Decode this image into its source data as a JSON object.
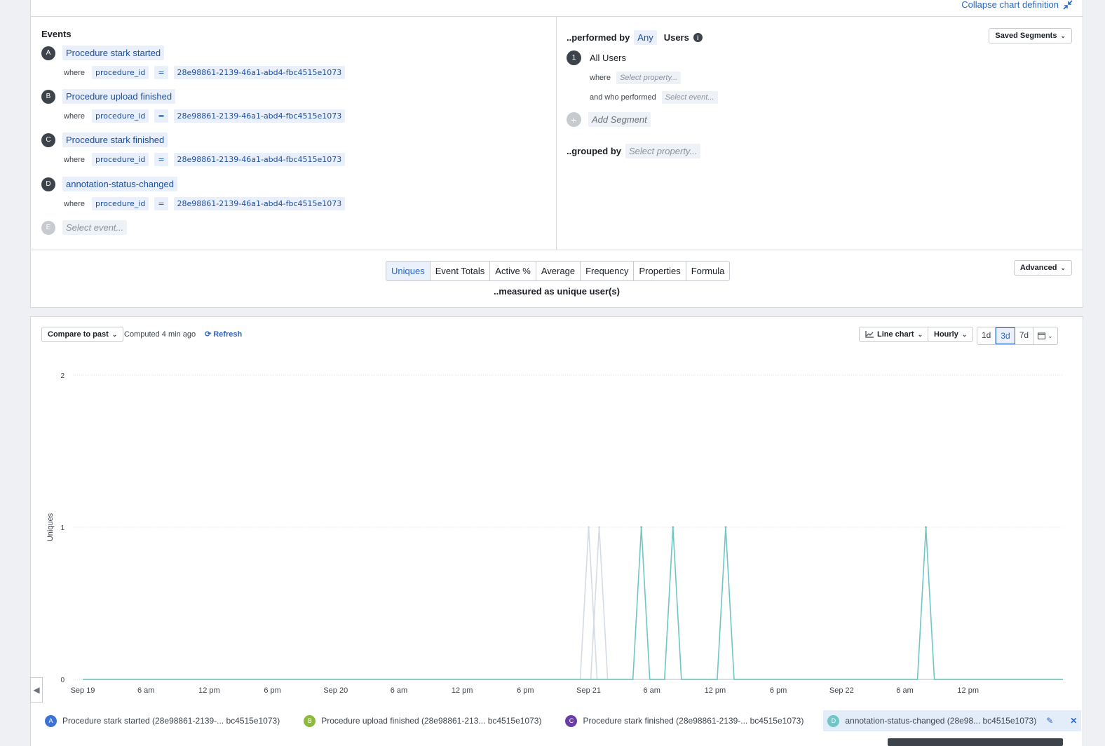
{
  "definition": {
    "collapse_label": "Collapse chart definition",
    "events_title": "Events",
    "events": [
      {
        "letter": "A",
        "name": "Procedure stark started",
        "where": "where",
        "prop": "procedure_id",
        "op": "=",
        "value": "28e98861-2139-46a1-abd4-fbc4515e1073"
      },
      {
        "letter": "B",
        "name": "Procedure upload finished",
        "where": "where",
        "prop": "procedure_id",
        "op": "=",
        "value": "28e98861-2139-46a1-abd4-fbc4515e1073"
      },
      {
        "letter": "C",
        "name": "Procedure stark finished",
        "where": "where",
        "prop": "procedure_id",
        "op": "=",
        "value": "28e98861-2139-46a1-abd4-fbc4515e1073"
      },
      {
        "letter": "D",
        "name": "annotation-status-changed",
        "where": "where",
        "prop": "procedure_id",
        "op": "=",
        "value": "28e98861-2139-46a1-abd4-fbc4515e1073"
      }
    ],
    "empty_event": {
      "letter": "E",
      "placeholder": "Select event..."
    },
    "performed_by": {
      "prefix": "..performed by",
      "any": "Any",
      "users": "Users",
      "info_icon": "info-icon"
    },
    "saved_segments": "Saved Segments",
    "segment": {
      "number": "1",
      "name": "All Users",
      "where": "where",
      "where_placeholder": "Select property...",
      "performed": "and who performed",
      "performed_placeholder": "Select event..."
    },
    "add_segment": "Add Segment",
    "grouped_by": {
      "label": "..grouped by",
      "placeholder": "Select property..."
    },
    "measure_tabs": [
      "Uniques",
      "Event Totals",
      "Active %",
      "Average",
      "Frequency",
      "Properties",
      "Formula"
    ],
    "active_tab": "Uniques",
    "measured_as": "..measured as unique user(s)",
    "advanced": "Advanced"
  },
  "toolbar": {
    "compare": "Compare to past",
    "computed": "Computed 4 min ago",
    "refresh": "Refresh",
    "chart_type": "Line chart",
    "interval": "Hourly",
    "ranges": [
      "1d",
      "3d",
      "7d"
    ],
    "active_range": "3d"
  },
  "chart_data": {
    "type": "line",
    "ylabel": "Uniques",
    "ylim": [
      0,
      2
    ],
    "yticks": [
      "0",
      "1",
      "2"
    ],
    "x_range_hours": [
      0,
      93
    ],
    "xticks": [
      {
        "label": "Sep 19",
        "hour": 0
      },
      {
        "label": "6 am",
        "hour": 6
      },
      {
        "label": "12 pm",
        "hour": 12
      },
      {
        "label": "6 pm",
        "hour": 18
      },
      {
        "label": "Sep 20",
        "hour": 24
      },
      {
        "label": "6 am",
        "hour": 30
      },
      {
        "label": "12 pm",
        "hour": 36
      },
      {
        "label": "6 pm",
        "hour": 42
      },
      {
        "label": "Sep 21",
        "hour": 48
      },
      {
        "label": "6 am",
        "hour": 54
      },
      {
        "label": "12 pm",
        "hour": 60
      },
      {
        "label": "6 pm",
        "hour": 66
      },
      {
        "label": "Sep 22",
        "hour": 72
      },
      {
        "label": "6 am",
        "hour": 78
      },
      {
        "label": "12 pm",
        "hour": 84
      }
    ],
    "series": [
      {
        "name": "Procedure stark started (28e98861-2139-... bc4515e1073)",
        "color": "#d5dbe2",
        "spikes": [
          48
        ]
      },
      {
        "name": "Procedure upload finished (28e98861-213... bc4515e1073)",
        "color": "#d5dbe2",
        "spikes": [
          49
        ]
      },
      {
        "name": "Procedure stark finished (28e98861-2139-... bc4515e1073)",
        "color": "#d5dbe2",
        "spikes": []
      },
      {
        "name": "annotation-status-changed (28e98... bc4515e1073)",
        "color": "#6ec6c6",
        "spikes": [
          53,
          56,
          61,
          80
        ]
      }
    ]
  },
  "legend": [
    {
      "letter": "A",
      "color": "#3b73d9",
      "label": "Procedure stark started (28e98861-2139-... bc4515e1073)"
    },
    {
      "letter": "B",
      "color": "#8db93e",
      "label": "Procedure upload finished (28e98861-213... bc4515e1073)"
    },
    {
      "letter": "C",
      "color": "#6a3ca7",
      "label": "Procedure stark finished (28e98861-2139-... bc4515e1073)"
    },
    {
      "letter": "D",
      "color": "#6ec6c6",
      "label": "annotation-status-changed (28e98... bc4515e1073)"
    }
  ]
}
